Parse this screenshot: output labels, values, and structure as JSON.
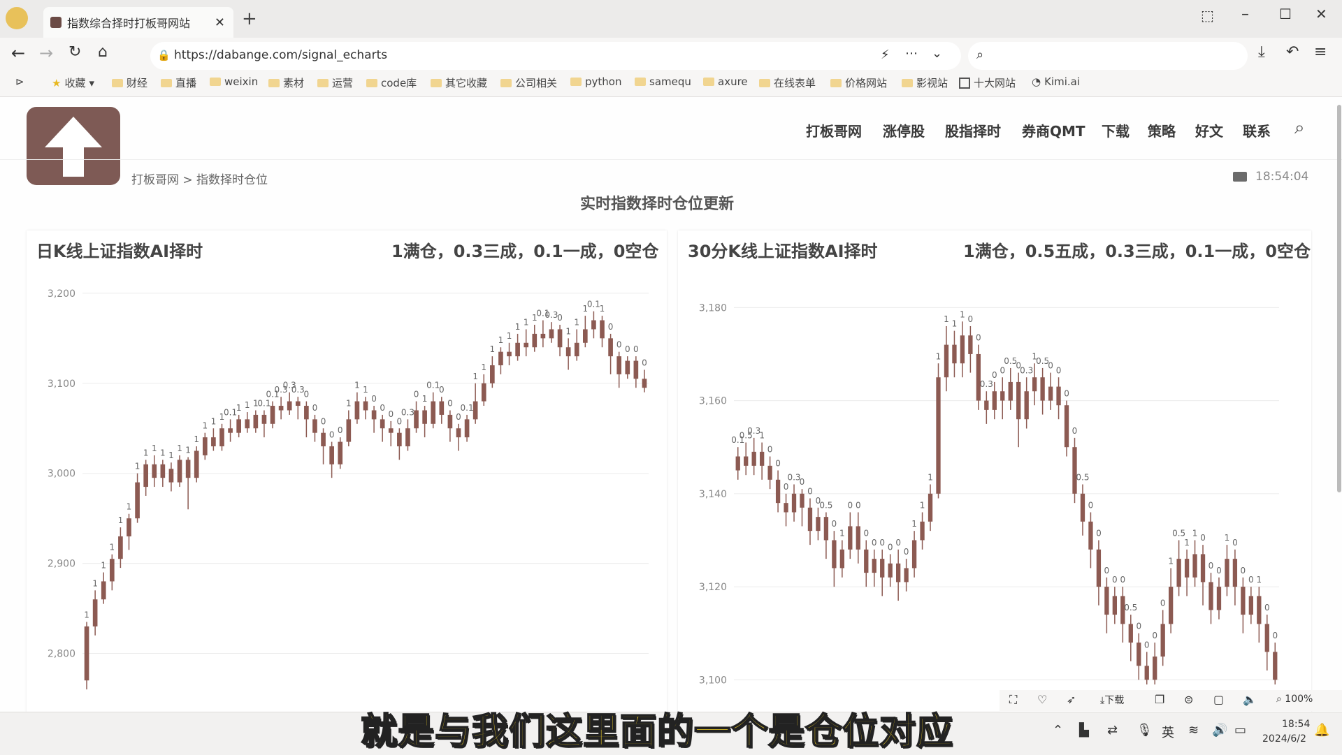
{
  "browser": {
    "tab_title": "指数综合择时打板哥网站",
    "url": "https://dabange.com/signal_echarts",
    "search_placeholder": "",
    "bookmarks": [
      "收藏",
      "财经",
      "直播",
      "weixin",
      "素材",
      "运营",
      "code库",
      "其它收藏",
      "公司相关",
      "python",
      "samequ",
      "axure",
      "在线表单",
      "价格网站",
      "影视站",
      "十大网站",
      "Kimi.ai"
    ]
  },
  "site": {
    "nav": [
      "打板哥网",
      "涨停股",
      "股指择时",
      "券商QMT",
      "下载",
      "策略",
      "好文",
      "联系"
    ],
    "breadcrumb": "打板哥网 > 指数择时仓位",
    "time": "18:54:04",
    "page_title": "实时指数择时仓位更新"
  },
  "panels": [
    {
      "title": "日K线上证指数AI择时",
      "legend": "1满仓，0.3三成，0.1一成，0空仓"
    },
    {
      "title": "30分K线上证指数AI择时",
      "legend": "1满仓，0.5五成，0.3三成，0.1一成，0空仓"
    }
  ],
  "colors": {
    "candle": "#8c5a52",
    "accent": "#7d5550"
  },
  "chart_data": [
    {
      "type": "candlestick",
      "title": "日K线上证指数AI择时",
      "ylim": [
        2750,
        3210
      ],
      "yticks": [
        "3,200",
        "3,100",
        "3,000",
        "2,900",
        "2,800"
      ],
      "grid": true,
      "series": [
        {
          "values": [
            [
              2770,
              2830,
              2760,
              2835
            ],
            [
              2830,
              2860,
              2820,
              2870
            ],
            [
              2860,
              2880,
              2855,
              2890
            ],
            [
              2880,
              2905,
              2870,
              2910
            ],
            [
              2905,
              2930,
              2895,
              2940
            ],
            [
              2930,
              2950,
              2915,
              2955
            ],
            [
              2950,
              2990,
              2945,
              3000
            ],
            [
              2985,
              3010,
              2975,
              3015
            ],
            [
              3010,
              2995,
              2985,
              3020
            ],
            [
              2995,
              3010,
              2985,
              3015
            ],
            [
              3005,
              2990,
              2980,
              3012
            ],
            [
              2990,
              3015,
              2985,
              3020
            ],
            [
              3015,
              2995,
              2960,
              3018
            ],
            [
              2995,
              3025,
              2990,
              3030
            ],
            [
              3020,
              3040,
              3015,
              3045
            ],
            [
              3040,
              3030,
              3025,
              3050
            ],
            [
              3030,
              3050,
              3025,
              3055
            ],
            [
              3050,
              3045,
              3035,
              3060
            ],
            [
              3045,
              3060,
              3040,
              3065
            ],
            [
              3060,
              3050,
              3045,
              3068
            ],
            [
              3050,
              3065,
              3045,
              3070
            ],
            [
              3065,
              3055,
              3040,
              3070
            ],
            [
              3055,
              3075,
              3050,
              3080
            ],
            [
              3075,
              3070,
              3060,
              3085
            ],
            [
              3070,
              3080,
              3065,
              3090
            ],
            [
              3080,
              3075,
              3060,
              3085
            ],
            [
              3075,
              3060,
              3040,
              3080
            ],
            [
              3060,
              3045,
              3035,
              3065
            ],
            [
              3045,
              3030,
              3010,
              3050
            ],
            [
              3030,
              3010,
              2995,
              3035
            ],
            [
              3010,
              3035,
              3005,
              3040
            ],
            [
              3035,
              3060,
              3030,
              3070
            ],
            [
              3060,
              3080,
              3055,
              3090
            ],
            [
              3080,
              3070,
              3060,
              3085
            ],
            [
              3070,
              3060,
              3045,
              3075
            ],
            [
              3060,
              3050,
              3035,
              3065
            ],
            [
              3050,
              3045,
              3030,
              3058
            ],
            [
              3045,
              3030,
              3015,
              3050
            ],
            [
              3030,
              3050,
              3025,
              3060
            ],
            [
              3050,
              3070,
              3045,
              3080
            ],
            [
              3070,
              3055,
              3040,
              3075
            ],
            [
              3055,
              3080,
              3050,
              3090
            ],
            [
              3080,
              3065,
              3055,
              3085
            ],
            [
              3065,
              3050,
              3035,
              3070
            ],
            [
              3050,
              3040,
              3025,
              3055
            ],
            [
              3040,
              3060,
              3035,
              3065
            ],
            [
              3060,
              3080,
              3055,
              3100
            ],
            [
              3080,
              3100,
              3075,
              3110
            ],
            [
              3100,
              3120,
              3095,
              3130
            ],
            [
              3120,
              3135,
              3110,
              3140
            ],
            [
              3135,
              3130,
              3120,
              3145
            ],
            [
              3130,
              3145,
              3125,
              3155
            ],
            [
              3145,
              3140,
              3130,
              3160
            ],
            [
              3140,
              3155,
              3135,
              3165
            ],
            [
              3155,
              3150,
              3140,
              3170
            ],
            [
              3150,
              3160,
              3145,
              3168
            ],
            [
              3160,
              3140,
              3130,
              3165
            ],
            [
              3140,
              3130,
              3115,
              3150
            ],
            [
              3130,
              3145,
              3125,
              3160
            ],
            [
              3145,
              3160,
              3140,
              3175
            ],
            [
              3160,
              3170,
              3150,
              3180
            ],
            [
              3170,
              3150,
              3140,
              3175
            ],
            [
              3150,
              3130,
              3110,
              3155
            ],
            [
              3130,
              3110,
              3095,
              3135
            ],
            [
              3110,
              3125,
              3105,
              3130
            ],
            [
              3125,
              3105,
              3095,
              3130
            ],
            [
              3105,
              3095,
              3090,
              3115
            ]
          ]
        },
        {
          "name": "position_labels",
          "values": [
            "1",
            "1",
            "1",
            "1",
            "1",
            "1",
            "1",
            "1",
            "1",
            "1",
            "1",
            "1",
            "1",
            "1",
            "1",
            "1",
            "1",
            "0.1",
            "1",
            "1",
            "1",
            "0.1",
            "0.1",
            "0.3",
            "0.3",
            "0.3",
            "0",
            "0",
            "0",
            "0",
            "0",
            "1",
            "1",
            "1",
            "0",
            "0",
            "0",
            "0",
            "0.3",
            "0",
            "1",
            "0.1",
            "0",
            "0",
            "0",
            "0.1",
            "1",
            "1",
            "1",
            "1",
            "1",
            "1",
            "1",
            "1",
            "0.1",
            "0.3",
            "0",
            "1",
            "1",
            "1",
            "0.1",
            "1",
            "0",
            "0",
            "0",
            "0",
            "0"
          ]
        }
      ]
    },
    {
      "type": "candlestick",
      "title": "30分K线上证指数AI择时",
      "ylim": [
        3099,
        3185
      ],
      "yticks": [
        "3,180",
        "3,160",
        "3,140",
        "3,120",
        "3,100"
      ],
      "grid": true,
      "series": [
        {
          "values": [
            [
              3145,
              3148,
              3143,
              3150
            ],
            [
              3148,
              3146,
              3144,
              3151
            ],
            [
              3146,
              3149,
              3144,
              3152
            ],
            [
              3149,
              3146,
              3143,
              3151
            ],
            [
              3146,
              3143,
              3141,
              3148
            ],
            [
              3143,
              3138,
              3136,
              3145
            ],
            [
              3138,
              3136,
              3133,
              3140
            ],
            [
              3136,
              3140,
              3134,
              3142
            ],
            [
              3140,
              3137,
              3133,
              3141
            ],
            [
              3137,
              3132,
              3129,
              3139
            ],
            [
              3132,
              3135,
              3130,
              3137
            ],
            [
              3135,
              3130,
              3126,
              3136
            ],
            [
              3130,
              3124,
              3120,
              3132
            ],
            [
              3124,
              3128,
              3122,
              3130
            ],
            [
              3128,
              3133,
              3126,
              3136
            ],
            [
              3133,
              3128,
              3125,
              3136
            ],
            [
              3128,
              3123,
              3120,
              3130
            ],
            [
              3123,
              3126,
              3120,
              3128
            ],
            [
              3126,
              3122,
              3118,
              3128
            ],
            [
              3122,
              3125,
              3120,
              3127
            ],
            [
              3125,
              3121,
              3117,
              3128
            ],
            [
              3121,
              3124,
              3119,
              3126
            ],
            [
              3124,
              3130,
              3122,
              3132
            ],
            [
              3130,
              3134,
              3128,
              3136
            ],
            [
              3134,
              3140,
              3132,
              3142
            ],
            [
              3140,
              3165,
              3139,
              3168
            ],
            [
              3165,
              3172,
              3162,
              3176
            ],
            [
              3172,
              3168,
              3165,
              3175
            ],
            [
              3168,
              3174,
              3165,
              3177
            ],
            [
              3174,
              3170,
              3166,
              3176
            ],
            [
              3170,
              3160,
              3158,
              3172
            ],
            [
              3160,
              3158,
              3155,
              3162
            ],
            [
              3158,
              3162,
              3156,
              3164
            ],
            [
              3162,
              3160,
              3156,
              3165
            ],
            [
              3160,
              3164,
              3158,
              3167
            ],
            [
              3164,
              3156,
              3150,
              3166
            ],
            [
              3156,
              3162,
              3154,
              3165
            ],
            [
              3162,
              3165,
              3159,
              3168
            ],
            [
              3165,
              3160,
              3157,
              3167
            ],
            [
              3160,
              3163,
              3158,
              3166
            ],
            [
              3163,
              3159,
              3156,
              3165
            ],
            [
              3159,
              3150,
              3148,
              3160
            ],
            [
              3150,
              3140,
              3138,
              3152
            ],
            [
              3140,
              3134,
              3131,
              3142
            ],
            [
              3134,
              3128,
              3124,
              3136
            ],
            [
              3128,
              3120,
              3116,
              3130
            ],
            [
              3120,
              3114,
              3110,
              3122
            ],
            [
              3114,
              3118,
              3112,
              3120
            ],
            [
              3118,
              3112,
              3108,
              3120
            ],
            [
              3112,
              3108,
              3104,
              3114
            ],
            [
              3108,
              3103,
              3100,
              3110
            ],
            [
              3103,
              3100,
              3099,
              3106
            ],
            [
              3100,
              3105,
              3099,
              3108
            ],
            [
              3105,
              3112,
              3103,
              3115
            ],
            [
              3112,
              3120,
              3110,
              3124
            ],
            [
              3120,
              3126,
              3118,
              3130
            ],
            [
              3126,
              3122,
              3118,
              3128
            ],
            [
              3122,
              3127,
              3120,
              3130
            ],
            [
              3127,
              3121,
              3116,
              3129
            ],
            [
              3121,
              3115,
              3112,
              3123
            ],
            [
              3115,
              3120,
              3113,
              3122
            ],
            [
              3120,
              3126,
              3118,
              3129
            ],
            [
              3126,
              3120,
              3116,
              3128
            ],
            [
              3120,
              3114,
              3110,
              3122
            ],
            [
              3114,
              3118,
              3112,
              3120
            ],
            [
              3118,
              3112,
              3108,
              3120
            ],
            [
              3112,
              3106,
              3102,
              3114
            ],
            [
              3106,
              3100,
              3099,
              3108
            ]
          ]
        },
        {
          "name": "position_labels",
          "values": [
            "0.1",
            "0.5",
            "0.3",
            "1",
            "0",
            "0",
            "0",
            "0.3",
            "0",
            "0",
            "0",
            "0.5",
            "0",
            "1",
            "0",
            "0",
            "0",
            "0",
            "0",
            "0",
            "0",
            "0",
            "1",
            "1",
            "1",
            "1",
            "1",
            "1",
            "1",
            "0",
            "0",
            "0.3",
            "0",
            "0",
            "0.5",
            "0",
            "0.3",
            "1",
            "0.5",
            "0",
            "0",
            "0",
            "0",
            "0.5",
            "0",
            "0",
            "0",
            "0",
            "0",
            "0.5",
            "0",
            "0",
            "0",
            "0",
            "1",
            "0.5",
            "1",
            "1",
            "0",
            "0",
            "0",
            "1",
            "0",
            "0",
            "0",
            "1",
            "0",
            "0"
          ]
        }
      ]
    }
  ],
  "overlay": {
    "subtitle": "就是与我们这里面的一个是仓位对应"
  },
  "statusbar": {
    "zoom": "100%",
    "download_label": "下载",
    "time": "18:54",
    "date": "2024/6/2",
    "ime": "英"
  }
}
